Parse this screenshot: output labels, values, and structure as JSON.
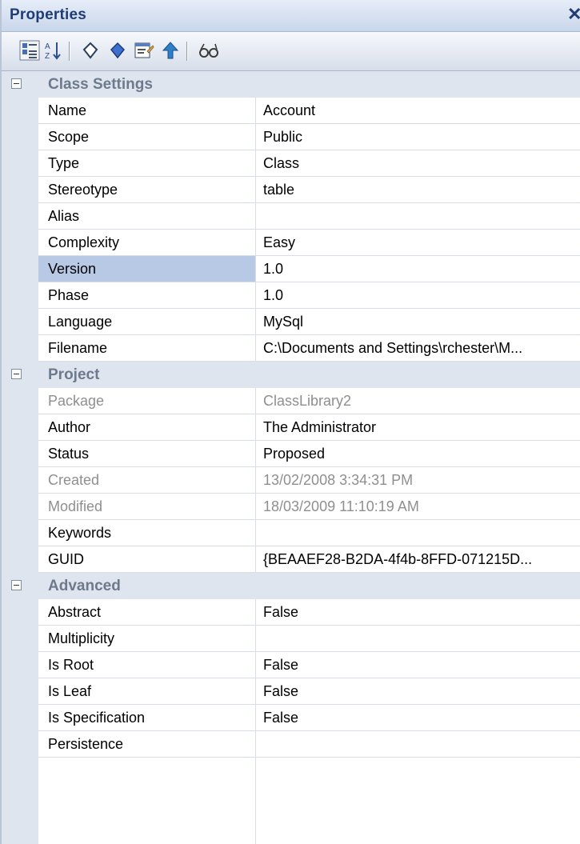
{
  "panel": {
    "title": "Properties"
  },
  "toolbar": {
    "buttons": [
      {
        "name": "categorized-button",
        "icon": "categorized-icon"
      },
      {
        "name": "alphabetical-button",
        "icon": "sort-alpha-icon"
      },
      {
        "name": "tag-outline-button",
        "icon": "tag-outline-icon"
      },
      {
        "name": "tag-filled-button",
        "icon": "tag-filled-icon"
      },
      {
        "name": "property-pages-button",
        "icon": "property-pages-icon"
      },
      {
        "name": "up-button",
        "icon": "up-arrow-icon"
      },
      {
        "name": "find-button",
        "icon": "glasses-icon"
      }
    ]
  },
  "categories": {
    "class_settings": "Class Settings",
    "project": "Project",
    "advanced": "Advanced"
  },
  "rows": {
    "name": {
      "label": "Name",
      "value": "Account"
    },
    "scope": {
      "label": "Scope",
      "value": "Public"
    },
    "type": {
      "label": "Type",
      "value": "Class"
    },
    "stereotype": {
      "label": "Stereotype",
      "value": "table"
    },
    "alias": {
      "label": "Alias",
      "value": ""
    },
    "complexity": {
      "label": "Complexity",
      "value": "Easy"
    },
    "version": {
      "label": "Version",
      "value": "1.0"
    },
    "phase": {
      "label": "Phase",
      "value": "1.0"
    },
    "language": {
      "label": "Language",
      "value": "MySql"
    },
    "filename": {
      "label": "Filename",
      "value": "C:\\Documents and Settings\\rchester\\M..."
    },
    "package": {
      "label": "Package",
      "value": "ClassLibrary2"
    },
    "author": {
      "label": "Author",
      "value": "The Administrator"
    },
    "status": {
      "label": "Status",
      "value": "Proposed"
    },
    "created": {
      "label": "Created",
      "value": "13/02/2008 3:34:31 PM"
    },
    "modified": {
      "label": "Modified",
      "value": "18/03/2009 11:10:19 AM"
    },
    "keywords": {
      "label": "Keywords",
      "value": ""
    },
    "guid": {
      "label": "GUID",
      "value": "{BEAAEF28-B2DA-4f4b-8FFD-071215D..."
    },
    "abstract": {
      "label": "Abstract",
      "value": "False"
    },
    "multiplicity": {
      "label": "Multiplicity",
      "value": ""
    },
    "is_root": {
      "label": "Is Root",
      "value": "False"
    },
    "is_leaf": {
      "label": "Is Leaf",
      "value": "False"
    },
    "is_specification": {
      "label": "Is Specification",
      "value": "False"
    },
    "persistence": {
      "label": "Persistence",
      "value": ""
    }
  },
  "colors": {
    "title_text": "#203d73",
    "category_bg": "#dfe5ee",
    "selected_bg": "#b8c9e6",
    "disabled_text": "#8f8f8f"
  }
}
